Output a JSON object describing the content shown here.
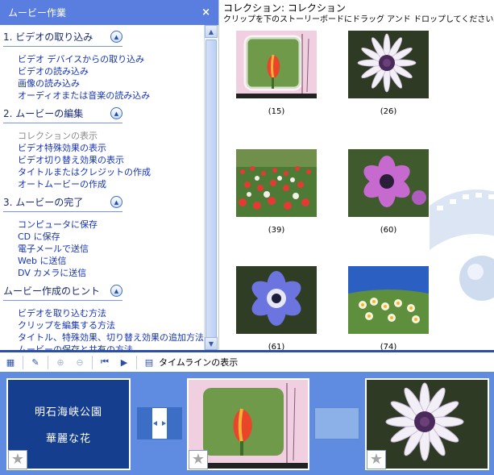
{
  "pane": {
    "title": "ムービー作業",
    "close": "×",
    "sections": [
      {
        "title": "1. ビデオの取り込み",
        "items": [
          {
            "label": "ビデオ デバイスからの取り込み"
          },
          {
            "label": "ビデオの読み込み"
          },
          {
            "label": "画像の読み込み"
          },
          {
            "label": "オーディオまたは音楽の読み込み"
          }
        ]
      },
      {
        "title": "2. ムービーの編集",
        "items": [
          {
            "label": "コレクションの表示"
          },
          {
            "label": "ビデオ特殊効果の表示"
          },
          {
            "label": "ビデオ切り替え効果の表示"
          },
          {
            "label": "タイトルまたはクレジットの作成"
          },
          {
            "label": "オートムービーの作成"
          }
        ]
      },
      {
        "title": "3. ムービーの完了",
        "items": [
          {
            "label": "コンピュータに保存"
          },
          {
            "label": "CD に保存"
          },
          {
            "label": "電子メールで送信"
          },
          {
            "label": "Web に送信"
          },
          {
            "label": "DV カメラに送信"
          }
        ]
      },
      {
        "title": "ムービー作成のヒント",
        "items": [
          {
            "label": "ビデオを取り込む方法"
          },
          {
            "label": "クリップを編集する方法"
          },
          {
            "label": "タイトル、特殊効果、切り替え効果の追加方法"
          },
          {
            "label": "ムービーの保存と共有の方法"
          }
        ]
      }
    ]
  },
  "collection": {
    "title": "コレクション: コレクション",
    "hint": "クリップを下のストーリーボードにドラッグ アンド ドロップしてください。",
    "clips": [
      {
        "label": "(15)",
        "subject": "tulip"
      },
      {
        "label": "(26)",
        "subject": "daisy"
      },
      {
        "label": "(39)",
        "subject": "tulip-field"
      },
      {
        "label": "(60)",
        "subject": "anemone-purple"
      },
      {
        "label": "(61)",
        "subject": "anemone-blue"
      },
      {
        "label": "(74)",
        "subject": "narcissus"
      }
    ]
  },
  "toolbar": {
    "timeline_label": "タイムラインの表示"
  },
  "storyboard": {
    "title_clip": {
      "line1": "明石海峡公園",
      "line2": "華麗な花"
    },
    "star": "★"
  },
  "colors": {
    "pane_header": "#5a7ee0",
    "link": "#1634b8",
    "storyboard_bg": "#5f8be0",
    "title_clip_bg": "#163e8f"
  }
}
